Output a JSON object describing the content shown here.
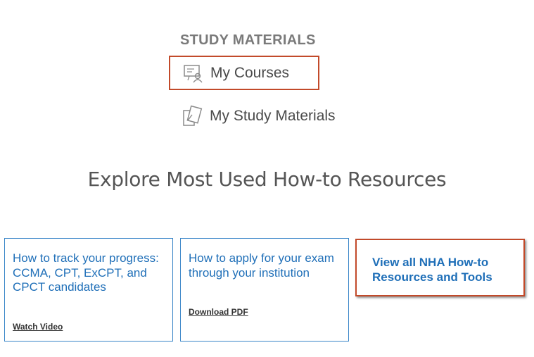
{
  "study": {
    "heading": "STUDY MATERIALS",
    "my_courses": "My Courses",
    "my_study_materials": "My Study Materials"
  },
  "explore": {
    "title": "Explore Most Used How-to Resources"
  },
  "cards": [
    {
      "title": "How to track your progress: CCMA, CPT, ExCPT, and CPCT candidates",
      "link": "Watch Video"
    },
    {
      "title": "How to apply for your exam through your institution",
      "link": "Download PDF"
    }
  ],
  "view_all": {
    "line1": "View all NHA How-to",
    "line2": "Resources and Tools"
  },
  "colors": {
    "accent_border": "#c24a2a",
    "link_blue": "#1f6fb8",
    "card_border": "#3a86c8",
    "heading_gray": "#7a7a7a"
  },
  "icons": {
    "courses": "course-presentation-icon",
    "materials": "study-materials-icon"
  }
}
